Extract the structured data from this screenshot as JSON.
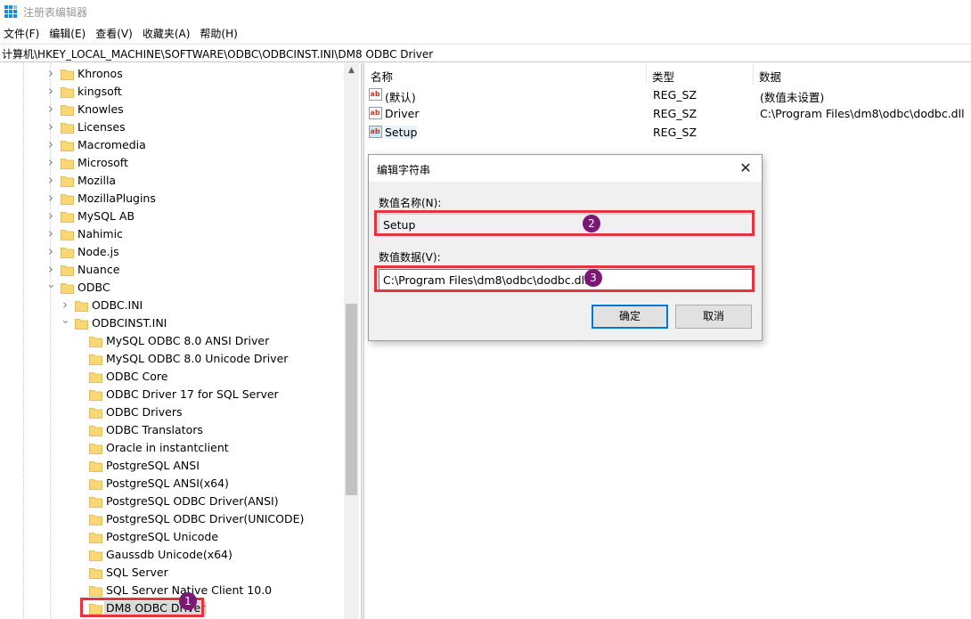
{
  "window": {
    "title": "注册表编辑器",
    "app_icon": "registry-editor-icon"
  },
  "menu": [
    "文件(F)",
    "编辑(E)",
    "查看(V)",
    "收藏夹(A)",
    "帮助(H)"
  ],
  "address": "计算机\\HKEY_LOCAL_MACHINE\\SOFTWARE\\ODBC\\ODBCINST.INI\\DM8 ODBC Driver",
  "tree": [
    {
      "label": "Khronos",
      "depth": 0,
      "chevron": "right"
    },
    {
      "label": "kingsoft",
      "depth": 0,
      "chevron": "right"
    },
    {
      "label": "Knowles",
      "depth": 0,
      "chevron": "right"
    },
    {
      "label": "Licenses",
      "depth": 0,
      "chevron": "right"
    },
    {
      "label": "Macromedia",
      "depth": 0,
      "chevron": "right"
    },
    {
      "label": "Microsoft",
      "depth": 0,
      "chevron": "right"
    },
    {
      "label": "Mozilla",
      "depth": 0,
      "chevron": "right"
    },
    {
      "label": "MozillaPlugins",
      "depth": 0,
      "chevron": "right"
    },
    {
      "label": "MySQL AB",
      "depth": 0,
      "chevron": "right"
    },
    {
      "label": "Nahimic",
      "depth": 0,
      "chevron": "right"
    },
    {
      "label": "Node.js",
      "depth": 0,
      "chevron": "right"
    },
    {
      "label": "Nuance",
      "depth": 0,
      "chevron": "right"
    },
    {
      "label": "ODBC",
      "depth": 0,
      "chevron": "down"
    },
    {
      "label": "ODBC.INI",
      "depth": 1,
      "chevron": "right"
    },
    {
      "label": "ODBCINST.INI",
      "depth": 1,
      "chevron": "down"
    },
    {
      "label": "MySQL ODBC 8.0 ANSI Driver",
      "depth": 2,
      "chevron": ""
    },
    {
      "label": "MySQL ODBC 8.0 Unicode Driver",
      "depth": 2,
      "chevron": ""
    },
    {
      "label": "ODBC Core",
      "depth": 2,
      "chevron": ""
    },
    {
      "label": "ODBC Driver 17 for SQL Server",
      "depth": 2,
      "chevron": ""
    },
    {
      "label": "ODBC Drivers",
      "depth": 2,
      "chevron": ""
    },
    {
      "label": "ODBC Translators",
      "depth": 2,
      "chevron": ""
    },
    {
      "label": "Oracle in instantclient",
      "depth": 2,
      "chevron": ""
    },
    {
      "label": "PostgreSQL ANSI",
      "depth": 2,
      "chevron": ""
    },
    {
      "label": "PostgreSQL ANSI(x64)",
      "depth": 2,
      "chevron": ""
    },
    {
      "label": "PostgreSQL ODBC Driver(ANSI)",
      "depth": 2,
      "chevron": ""
    },
    {
      "label": "PostgreSQL ODBC Driver(UNICODE)",
      "depth": 2,
      "chevron": ""
    },
    {
      "label": "PostgreSQL Unicode",
      "depth": 2,
      "chevron": ""
    },
    {
      "label": "Gaussdb Unicode(x64)",
      "depth": 2,
      "chevron": ""
    },
    {
      "label": "SQL Server",
      "depth": 2,
      "chevron": ""
    },
    {
      "label": "SQL Server Native Client 10.0",
      "depth": 2,
      "chevron": ""
    },
    {
      "label": "DM8 ODBC Driver",
      "depth": 2,
      "chevron": "",
      "selected": true
    }
  ],
  "list": {
    "headers": {
      "name": "名称",
      "type": "类型",
      "data": "数据"
    },
    "rows": [
      {
        "name": "(默认)",
        "type": "REG_SZ",
        "data": "(数值未设置)",
        "icon": "string-value-icon"
      },
      {
        "name": "Driver",
        "type": "REG_SZ",
        "data": "C:\\Program Files\\dm8\\odbc\\dodbc.dll",
        "icon": "string-value-icon"
      },
      {
        "name": "Setup",
        "type": "REG_SZ",
        "data": "",
        "icon": "string-value-icon",
        "selected": true
      }
    ]
  },
  "dialog": {
    "title": "编辑字符串",
    "name_label": "数值名称(N):",
    "name_value": "Setup",
    "data_label": "数值数据(V):",
    "data_value": "C:\\Program Files\\dm8\\odbc\\dodbc.dll",
    "ok_label": "确定",
    "cancel_label": "取消"
  },
  "annotations": [
    "1",
    "2",
    "3"
  ],
  "colors": {
    "highlight_border": "#e53340",
    "badge": "#7a1875",
    "folder": "#f8d775",
    "default_button_border": "#0078d7"
  }
}
